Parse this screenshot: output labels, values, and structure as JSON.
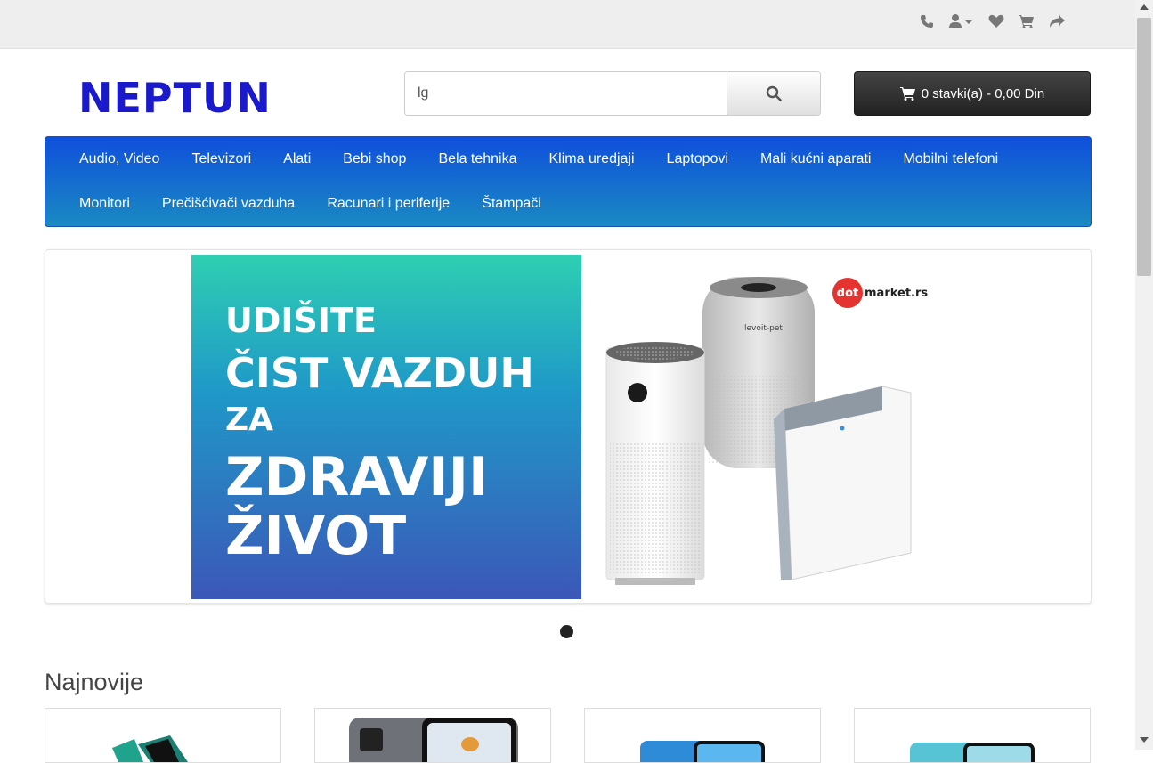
{
  "header": {
    "logo_text": "NEPTUN",
    "icons": [
      "phone-icon",
      "user-icon",
      "heart-icon",
      "cart-icon",
      "share-icon"
    ]
  },
  "search": {
    "value": "lg",
    "button_icon": "search-icon"
  },
  "cart": {
    "label": "0 stavki(a) - 0,00 Din",
    "icon": "cart-icon"
  },
  "nav": {
    "items": [
      "Audio, Video",
      "Televizori",
      "Alati",
      "Bebi shop",
      "Bela tehnika",
      "Klima uredjaji",
      "Laptopovi",
      "Mali kućni aparati",
      "Mobilni telefoni",
      "Monitori",
      "Prečišćivači vazduha",
      "Racunari i periferije",
      "Štampači"
    ]
  },
  "banner": {
    "lines": [
      "UDIŠITE",
      "ČIST VAZDUH",
      "ZA",
      "ZDRAVIJI",
      "ŽIVOT"
    ],
    "brand_dot": "dot",
    "brand_rest": "market.rs",
    "product_text": "levoit-pet"
  },
  "section": {
    "title": "Najnovije"
  },
  "colors": {
    "logo": "#1a1acc",
    "nav_top": "#0f4fdc",
    "nav_bottom": "#1a8ac2",
    "cart_bg": "#2b2b2b",
    "brand_red": "#e3342f"
  }
}
